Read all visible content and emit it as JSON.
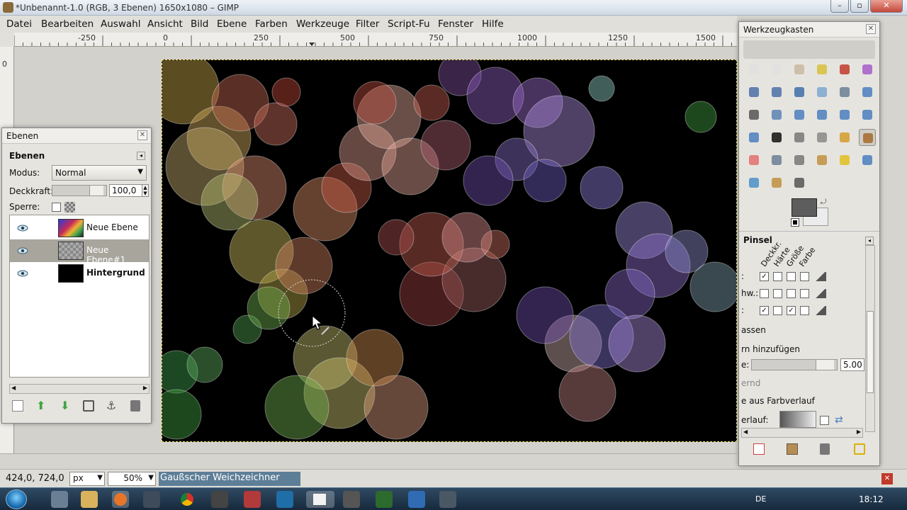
{
  "window": {
    "title": "*Unbenannt-1.0 (RGB, 3 Ebenen) 1650x1080 – GIMP"
  },
  "menu": [
    "Datei",
    "Bearbeiten",
    "Auswahl",
    "Ansicht",
    "Bild",
    "Ebene",
    "Farben",
    "Werkzeuge",
    "Filter",
    "Script-Fu",
    "Fenster",
    "Hilfe"
  ],
  "ruler": {
    "h_labels": [
      "-250",
      "0",
      "250",
      "500",
      "750",
      "1000",
      "1250",
      "1500"
    ],
    "v_labels": [
      "0"
    ]
  },
  "layers_dock": {
    "title": "Ebenen",
    "heading": "Ebenen",
    "mode_label": "Modus:",
    "mode_value": "Normal",
    "opacity_label": "Deckkraft:",
    "opacity_value": "100,0",
    "lock_label": "Sperre:",
    "layers": [
      {
        "name": "Neue Ebene",
        "selected": false
      },
      {
        "name": "Neue Ebene#1",
        "selected": true
      },
      {
        "name": "Hintergrund",
        "selected": false
      }
    ]
  },
  "toolbox": {
    "title": "Werkzeugkasten",
    "colors": {
      "foreground": "#5d5d5d",
      "background": "#ececec"
    },
    "brush_section": "Pinsel",
    "dynamics_headers": [
      "Deckkr.",
      "Härte",
      "Größe",
      "Farbe"
    ],
    "row_labels": [
      ":",
      "hw.:",
      ":"
    ],
    "option_lines": [
      "assen",
      "rn hinzufügen",
      "e:",
      "ernd",
      "e aus Farbverlauf",
      "erlauf:"
    ],
    "scale_value": "5.00"
  },
  "statusbar": {
    "coords": "424,0, 724,0",
    "unit": "px",
    "zoom": "50%",
    "message": "Gaußscher Weichzeichner"
  },
  "taskbar": {
    "lang": "DE",
    "time": "18:12"
  }
}
